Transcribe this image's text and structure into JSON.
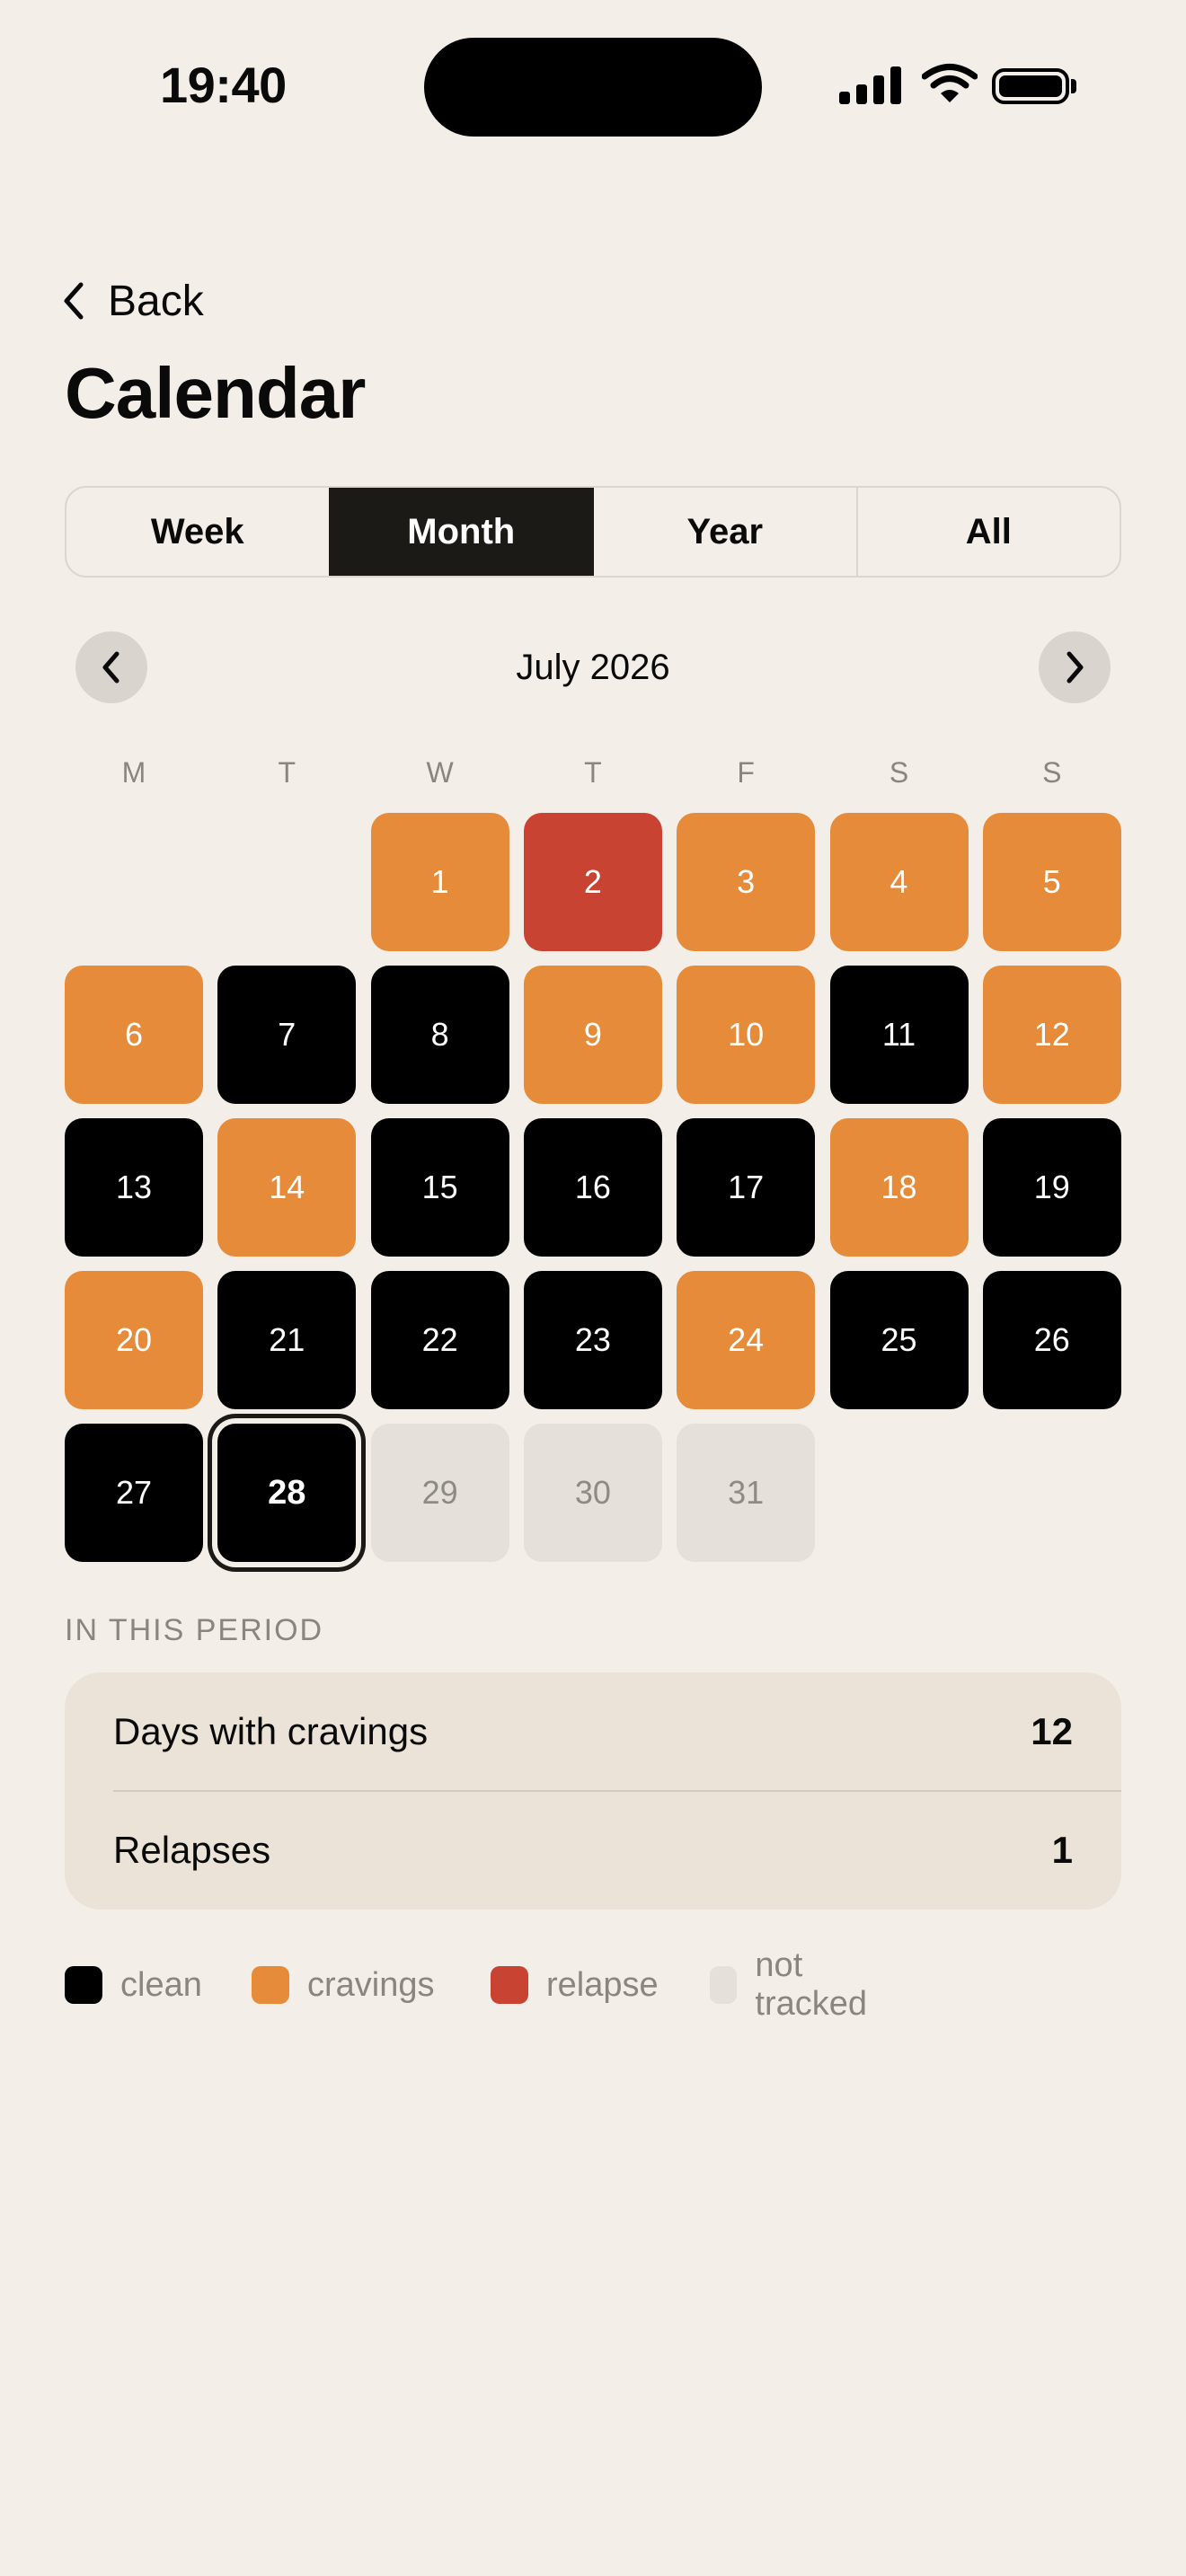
{
  "status": {
    "time": "19:40"
  },
  "nav": {
    "back_label": "Back"
  },
  "page": {
    "title": "Calendar"
  },
  "segments": [
    {
      "label": "Week",
      "active": false
    },
    {
      "label": "Month",
      "active": true
    },
    {
      "label": "Year",
      "active": false
    },
    {
      "label": "All",
      "active": false
    }
  ],
  "calendar": {
    "month_label": "July 2026",
    "weekdays": [
      "M",
      "T",
      "W",
      "T",
      "F",
      "S",
      "S"
    ],
    "first_weekday_index": 2,
    "today": 28,
    "days": [
      {
        "n": "1",
        "status": "cravings"
      },
      {
        "n": "2",
        "status": "relapse"
      },
      {
        "n": "3",
        "status": "cravings"
      },
      {
        "n": "4",
        "status": "cravings"
      },
      {
        "n": "5",
        "status": "cravings"
      },
      {
        "n": "6",
        "status": "cravings"
      },
      {
        "n": "7",
        "status": "clean"
      },
      {
        "n": "8",
        "status": "clean"
      },
      {
        "n": "9",
        "status": "cravings"
      },
      {
        "n": "10",
        "status": "cravings"
      },
      {
        "n": "11",
        "status": "clean"
      },
      {
        "n": "12",
        "status": "cravings"
      },
      {
        "n": "13",
        "status": "clean"
      },
      {
        "n": "14",
        "status": "cravings"
      },
      {
        "n": "15",
        "status": "clean"
      },
      {
        "n": "16",
        "status": "clean"
      },
      {
        "n": "17",
        "status": "clean"
      },
      {
        "n": "18",
        "status": "cravings"
      },
      {
        "n": "19",
        "status": "clean"
      },
      {
        "n": "20",
        "status": "cravings"
      },
      {
        "n": "21",
        "status": "clean"
      },
      {
        "n": "22",
        "status": "clean"
      },
      {
        "n": "23",
        "status": "clean"
      },
      {
        "n": "24",
        "status": "cravings"
      },
      {
        "n": "25",
        "status": "clean"
      },
      {
        "n": "26",
        "status": "clean"
      },
      {
        "n": "27",
        "status": "clean"
      },
      {
        "n": "28",
        "status": "clean"
      },
      {
        "n": "29",
        "status": "untracked"
      },
      {
        "n": "30",
        "status": "untracked"
      },
      {
        "n": "31",
        "status": "untracked"
      }
    ]
  },
  "period": {
    "section_label": "IN THIS PERIOD",
    "stats": [
      {
        "label": "Days with cravings",
        "value": "12"
      },
      {
        "label": "Relapses",
        "value": "1"
      }
    ]
  },
  "legend": [
    {
      "label": "clean",
      "color": "#000000"
    },
    {
      "label": "cravings",
      "color": "#E58B3A"
    },
    {
      "label": "relapse",
      "color": "#C94332"
    },
    {
      "label": "not tracked",
      "color": "#E5E0DA"
    }
  ],
  "icons": {
    "back": "chevron-left-icon",
    "prev_month": "chevron-left-icon",
    "next_month": "chevron-right-icon",
    "signal": "cellular-signal-icon",
    "wifi": "wifi-icon",
    "battery": "battery-icon"
  }
}
